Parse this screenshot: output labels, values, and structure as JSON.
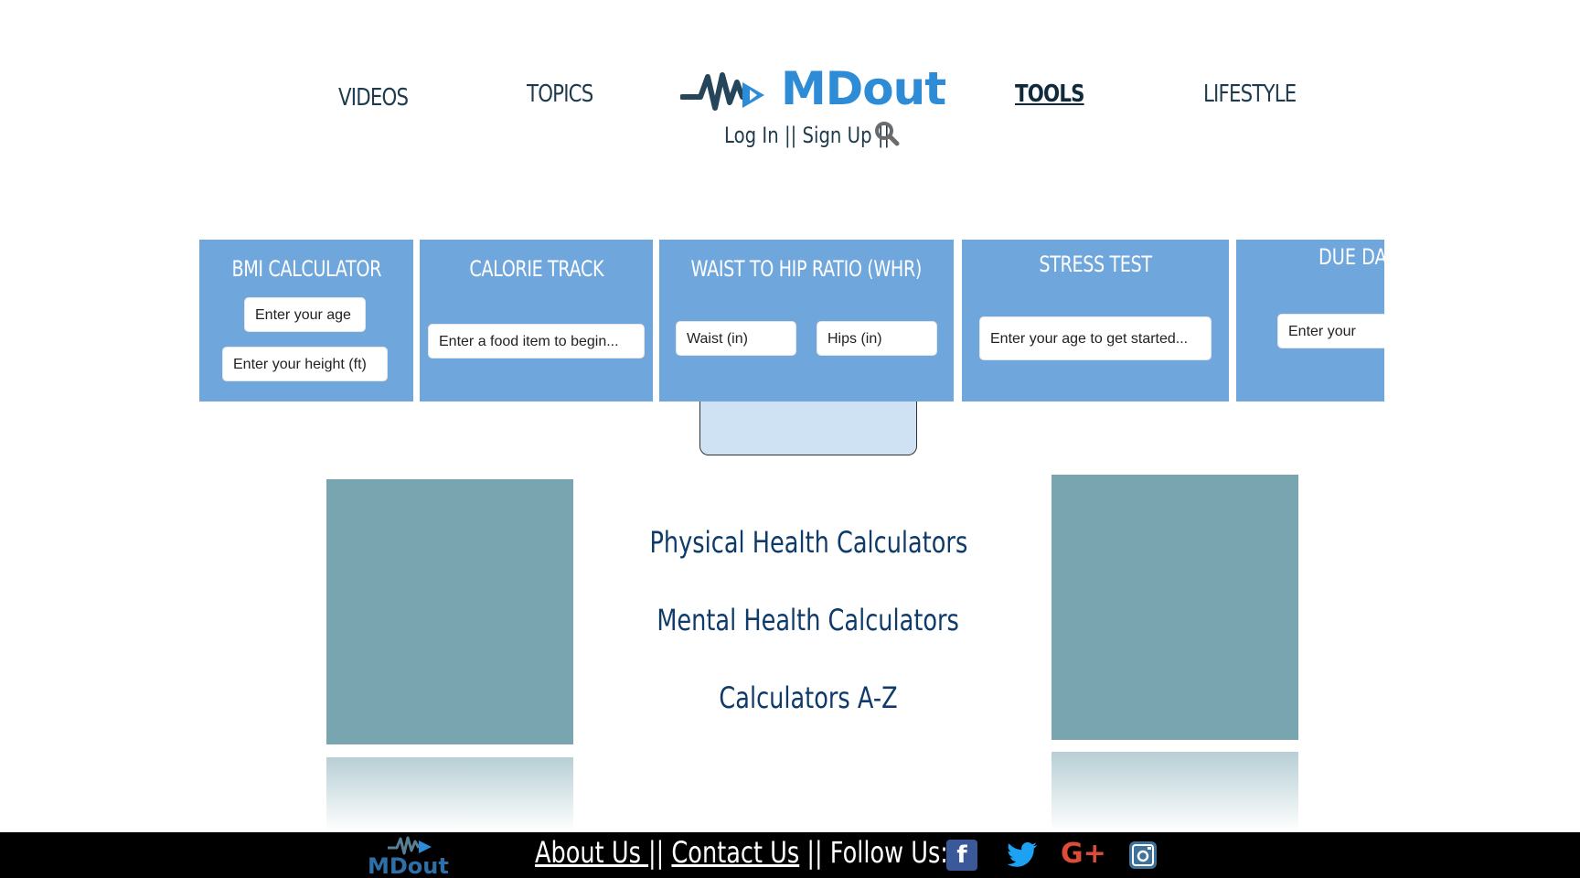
{
  "nav": {
    "videos": "VIDEOS",
    "topics": "TOPICS",
    "tools": "TOOLS",
    "lifestyle": "LIFESTYLE"
  },
  "logo": {
    "text": "MDout"
  },
  "auth": {
    "login": "Log In",
    "sep1": "||",
    "signup": "Sign Up",
    "sep2": "||"
  },
  "tools": [
    {
      "title": "BMI CALCULATOR",
      "fields": [
        "Enter your age",
        "Enter your height (ft)"
      ]
    },
    {
      "title": "CALORIE TRACK",
      "fields": [
        "Enter a food item to begin..."
      ]
    },
    {
      "title": "WAIST TO HIP RATIO (WHR)",
      "fields": [
        "Waist (in)",
        "Hips (in)"
      ]
    },
    {
      "title": "STRESS TEST",
      "fields": [
        "Enter your age to get started..."
      ]
    },
    {
      "title": "DUE DATE",
      "fields": [
        "Enter your"
      ]
    }
  ],
  "calculator_links": [
    "Physical Health Calculators",
    "Mental Health Calculators",
    "Calculators A-Z"
  ],
  "footer": {
    "logo_text": "MDout",
    "about": "About Us ",
    "sep1": "||",
    "contact": "Contact Us",
    "follow": " || Follow Us:"
  },
  "colors": {
    "card": "#6fa6dc",
    "teal_block": "#78a5b0",
    "link": "#0f3b6b",
    "facebook": "#3b5998",
    "twitter": "#1da1f2",
    "googleplus": "#dd4b39",
    "instagram": "#3f729b"
  },
  "icons": [
    "search-icon",
    "facebook-icon",
    "twitter-icon",
    "google-plus-icon",
    "instagram-icon"
  ]
}
